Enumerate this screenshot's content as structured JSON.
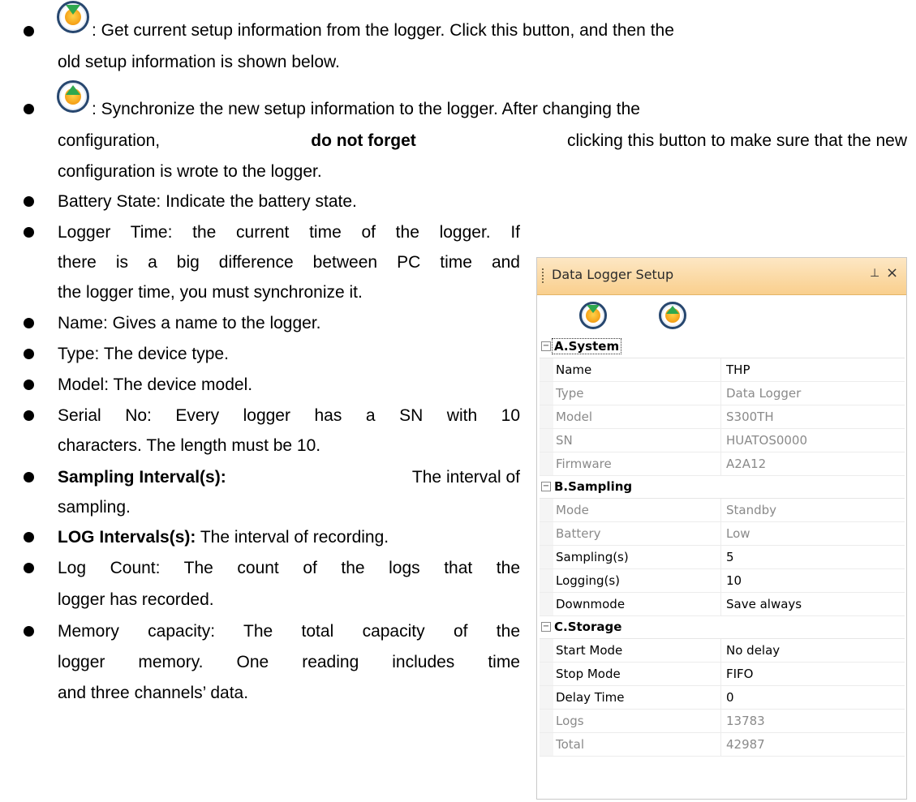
{
  "doc": {
    "get_desc_line1": ": Get current setup information from the logger. Click this button, and then the",
    "get_desc_line2": "old setup information is shown below.",
    "sync_desc_line1": ": Synchronize the new setup information to the logger. After changing the",
    "sync_desc_line2_a": "configuration,",
    "sync_desc_line2_bold": "do not forget",
    "sync_desc_line2_b": "clicking this button to make sure that the new",
    "sync_desc_line3": "configuration is wrote to the logger.",
    "bullets": [
      {
        "lines": [
          "Battery State: Indicate the battery state."
        ]
      },
      {
        "lines": [
          "Logger Time: the current time of the logger. If",
          "there is a big difference between PC time and",
          "the logger time, you must synchronize it."
        ]
      },
      {
        "lines": [
          "Name: Gives a name to the logger."
        ]
      },
      {
        "lines": [
          "Type: The device type."
        ]
      },
      {
        "lines": [
          "Model: The device model."
        ]
      },
      {
        "lines": [
          "Serial No: Every logger has a SN with 10",
          "characters. The length must be 10."
        ]
      }
    ],
    "sampling_bold": "Sampling Interval(s):",
    "sampling_rest": "The interval of",
    "sampling_line2": "sampling.",
    "log_bold": "LOG Intervals(s):",
    "log_rest": " The interval of recording.",
    "logcount_line1": "Log Count: The count of the logs that the",
    "logcount_line2": "logger has recorded.",
    "memory_line1": "Memory capacity: The total capacity of the",
    "memory_line2": "logger memory. One reading includes time",
    "memory_line3": "and three channels’ data."
  },
  "panel": {
    "title": "Data Logger Setup",
    "pin_glyph": "⊥",
    "close_glyph": "×",
    "categories": [
      {
        "label": "A.System",
        "rows": [
          {
            "name": "Name",
            "value": "THP",
            "readonly": false
          },
          {
            "name": "Type",
            "value": "Data Logger",
            "readonly": true
          },
          {
            "name": "Model",
            "value": "S300TH",
            "readonly": true
          },
          {
            "name": "SN",
            "value": "HUATOS0000",
            "readonly": true
          },
          {
            "name": "Firmware",
            "value": "A2A12",
            "readonly": true
          }
        ]
      },
      {
        "label": "B.Sampling",
        "rows": [
          {
            "name": "Mode",
            "value": "Standby",
            "readonly": true
          },
          {
            "name": "Battery",
            "value": "Low",
            "readonly": true
          },
          {
            "name": "Sampling(s)",
            "value": "5",
            "readonly": false
          },
          {
            "name": "Logging(s)",
            "value": "10",
            "readonly": false
          },
          {
            "name": "Downmode",
            "value": "Save always",
            "readonly": false
          }
        ]
      },
      {
        "label": "C.Storage",
        "rows": [
          {
            "name": "Start Mode",
            "value": "No delay",
            "readonly": false
          },
          {
            "name": "Stop Mode",
            "value": "FIFO",
            "readonly": false
          },
          {
            "name": "Delay Time",
            "value": "0",
            "readonly": false
          },
          {
            "name": "Logs",
            "value": "13783",
            "readonly": true
          },
          {
            "name": "Total",
            "value": "42987",
            "readonly": true
          }
        ]
      }
    ]
  },
  "colors": {
    "panel_title_bg": "#f9cf8d",
    "get_arrow": "#2fa84f",
    "sync_arrow": "#2fa84f",
    "icon_ring": "#27476f"
  }
}
